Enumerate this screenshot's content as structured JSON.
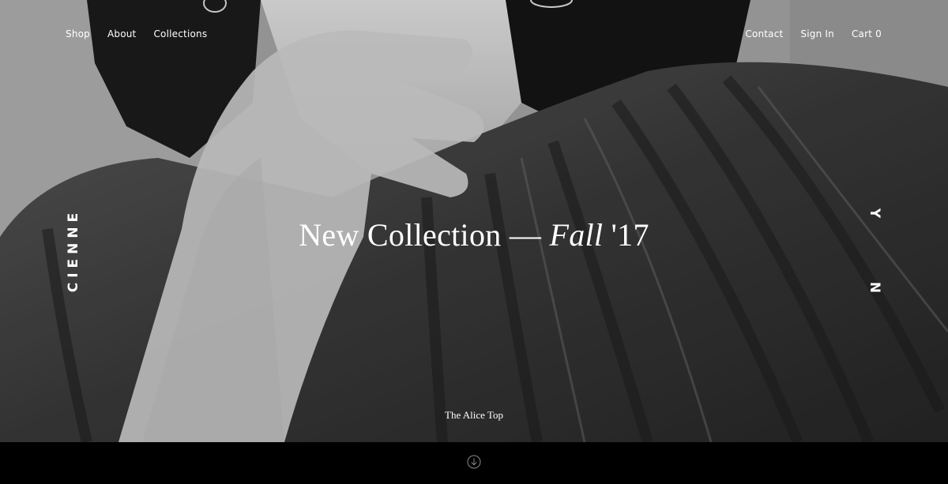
{
  "nav": {
    "left": [
      "Shop",
      "About",
      "Collections"
    ],
    "right": [
      "Contact",
      "Sign In",
      "Cart 0"
    ]
  },
  "brand": {
    "left": "CIENNE",
    "right_top": "Y",
    "right_bottom": "N"
  },
  "hero": {
    "headline_main": "New Collection — ",
    "headline_italic": "Fall",
    "headline_tail": " '17",
    "caption": "The Alice Top"
  },
  "icons": {
    "scroll": "arrow-down-circle-icon"
  },
  "colors": {
    "text": "#ffffff",
    "bar": "#000000"
  }
}
